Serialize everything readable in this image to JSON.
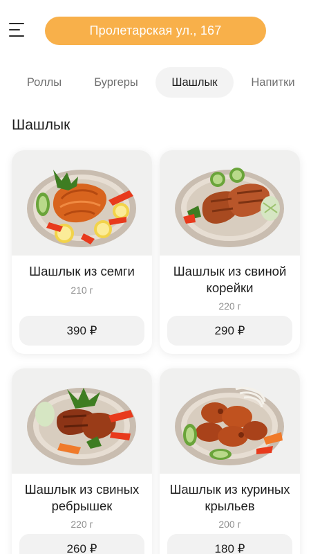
{
  "header": {
    "address": "Пролетарская ул., 167"
  },
  "tabs": [
    {
      "label": "Роллы",
      "active": false
    },
    {
      "label": "Бургеры",
      "active": false
    },
    {
      "label": "Шашлык",
      "active": true
    },
    {
      "label": "Напитки",
      "active": false
    }
  ],
  "section": {
    "title": "Шашлык"
  },
  "products": [
    {
      "name": "Шашлык из семги",
      "weight": "210 г",
      "price": "390 ₽"
    },
    {
      "name": "Шашлык из свиной корейки",
      "weight": "220 г",
      "price": "290 ₽"
    },
    {
      "name": "Шашлык из свиных ребрышек",
      "weight": "220 г",
      "price": "260 ₽"
    },
    {
      "name": "Шашлык из куриных крыльев",
      "weight": "200 г",
      "price": "180 ₽"
    }
  ],
  "colors": {
    "accent": "#f8b04a",
    "tab_active_bg": "#f3f3f3",
    "price_bg": "#f2f2f2"
  }
}
